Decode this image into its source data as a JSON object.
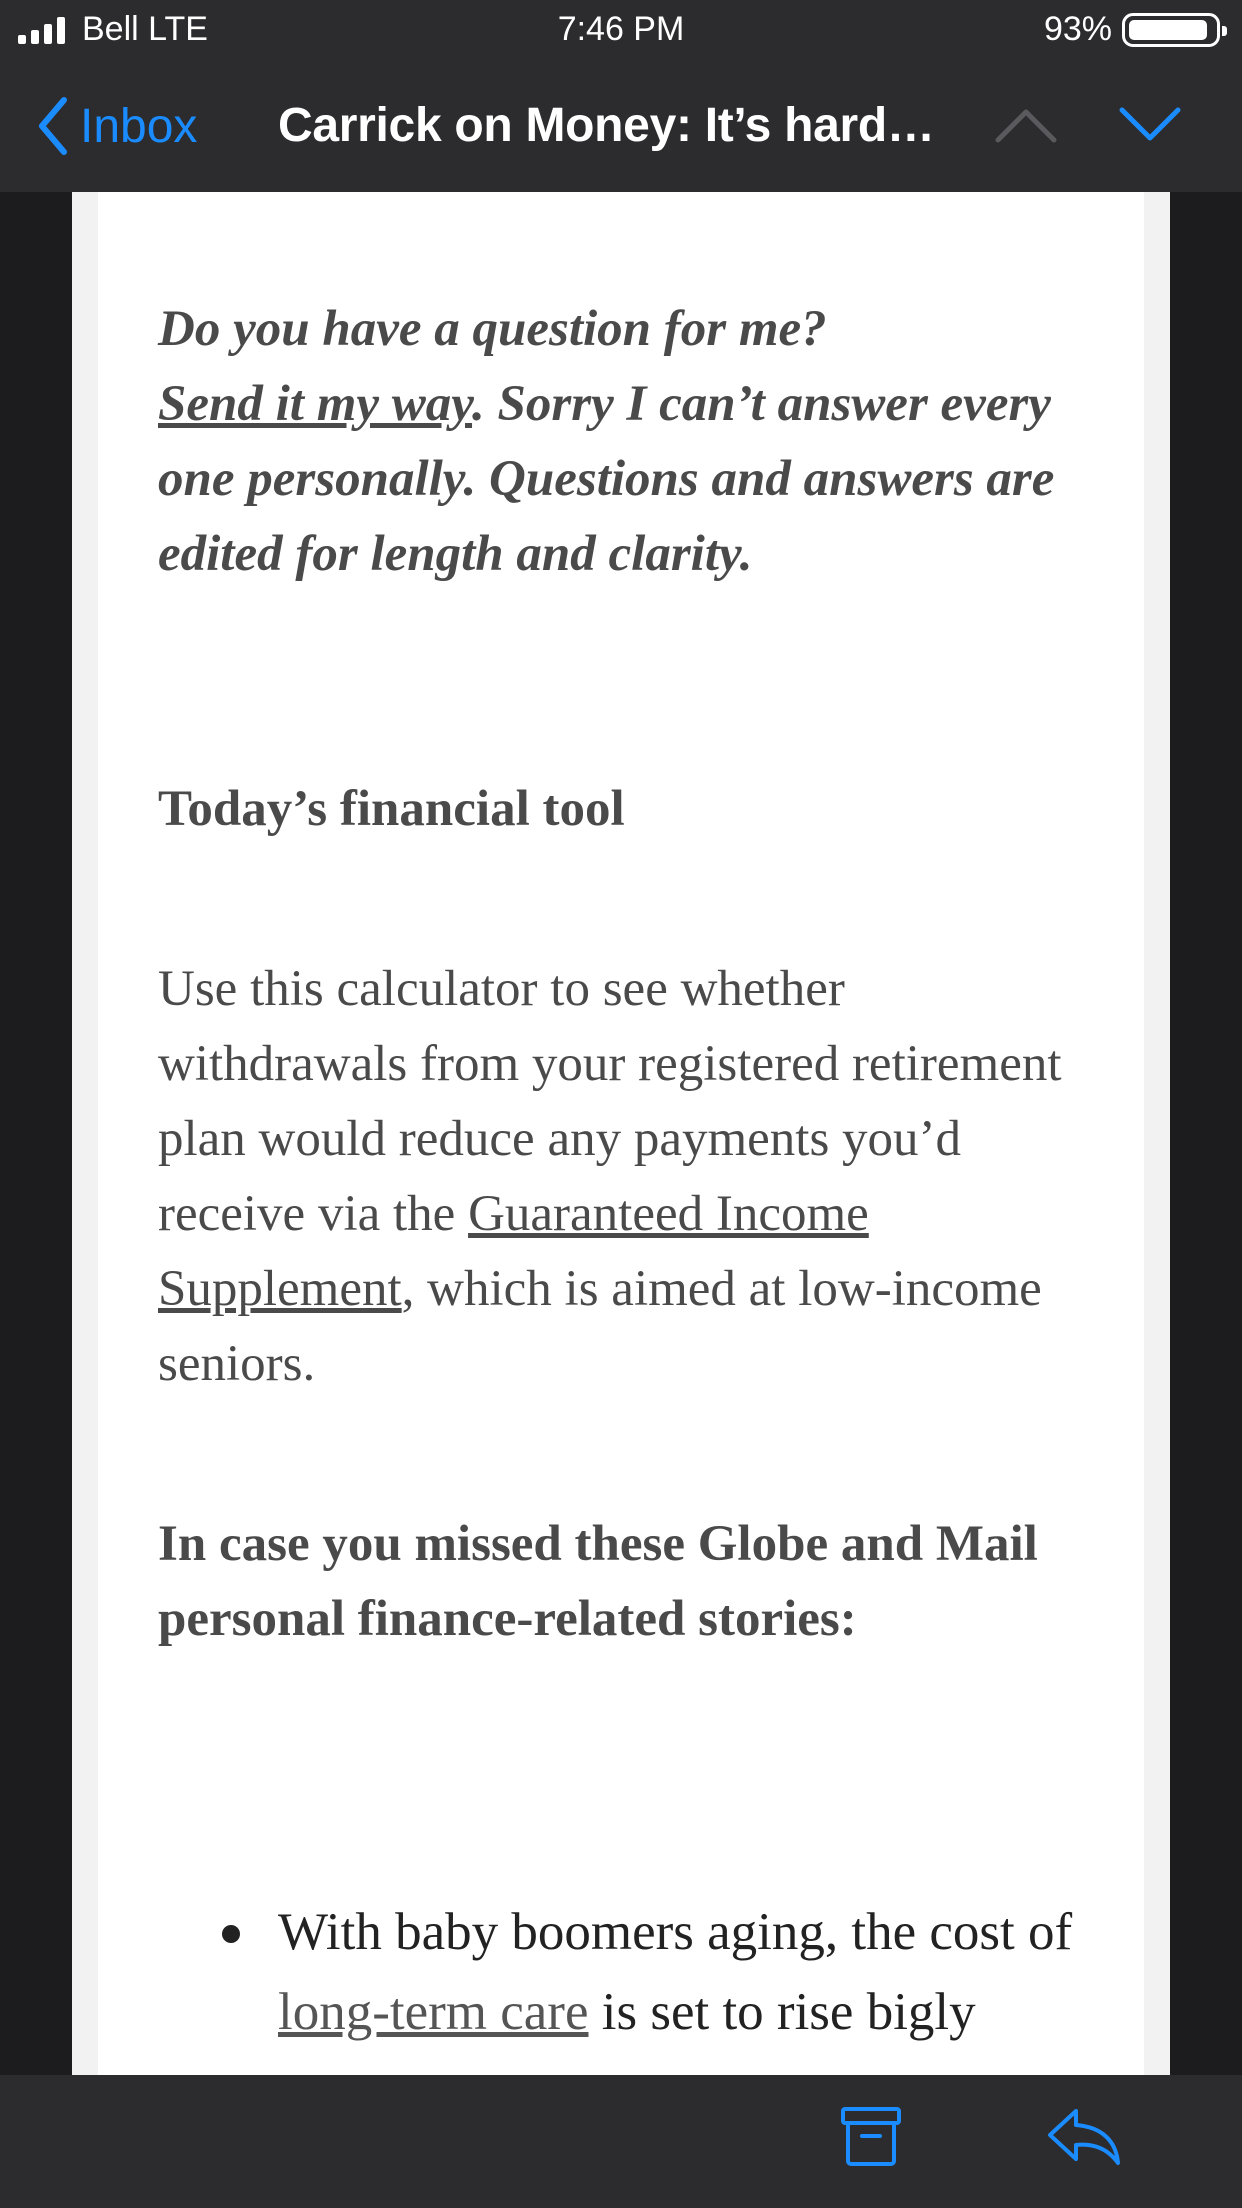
{
  "status_bar": {
    "carrier": "Bell LTE",
    "time": "7:46 PM",
    "battery": "93%",
    "battery_level": 0.93
  },
  "nav": {
    "back_label": "Inbox",
    "title": "Carrick on Money: It’s hard…",
    "accent_color": "#1a8cff"
  },
  "email": {
    "intro": {
      "line1": "Do you have a question for me?",
      "link": "Send it my way",
      "rest": ". Sorry I can’t answer every one personally. Questions and answers are edited for length and clarity."
    },
    "tool_heading": "Today’s financial tool",
    "tool_body": {
      "before_link": "Use this calculator to see whether withdrawals from your registered retirement plan would reduce any payments you’d receive via the ",
      "link": "Guaranteed Income Supplement",
      "after_link": ", which is aimed at low-income seniors."
    },
    "missed_heading": "In case you missed these Globe and Mail personal finance-related stories:",
    "stories": [
      {
        "before_link": "With baby boomers aging, the cost of ",
        "link": "long-term care",
        "after_link": " is set to rise bigly"
      }
    ]
  },
  "toolbar": {
    "icons": [
      "archive-icon",
      "reply-icon"
    ]
  }
}
